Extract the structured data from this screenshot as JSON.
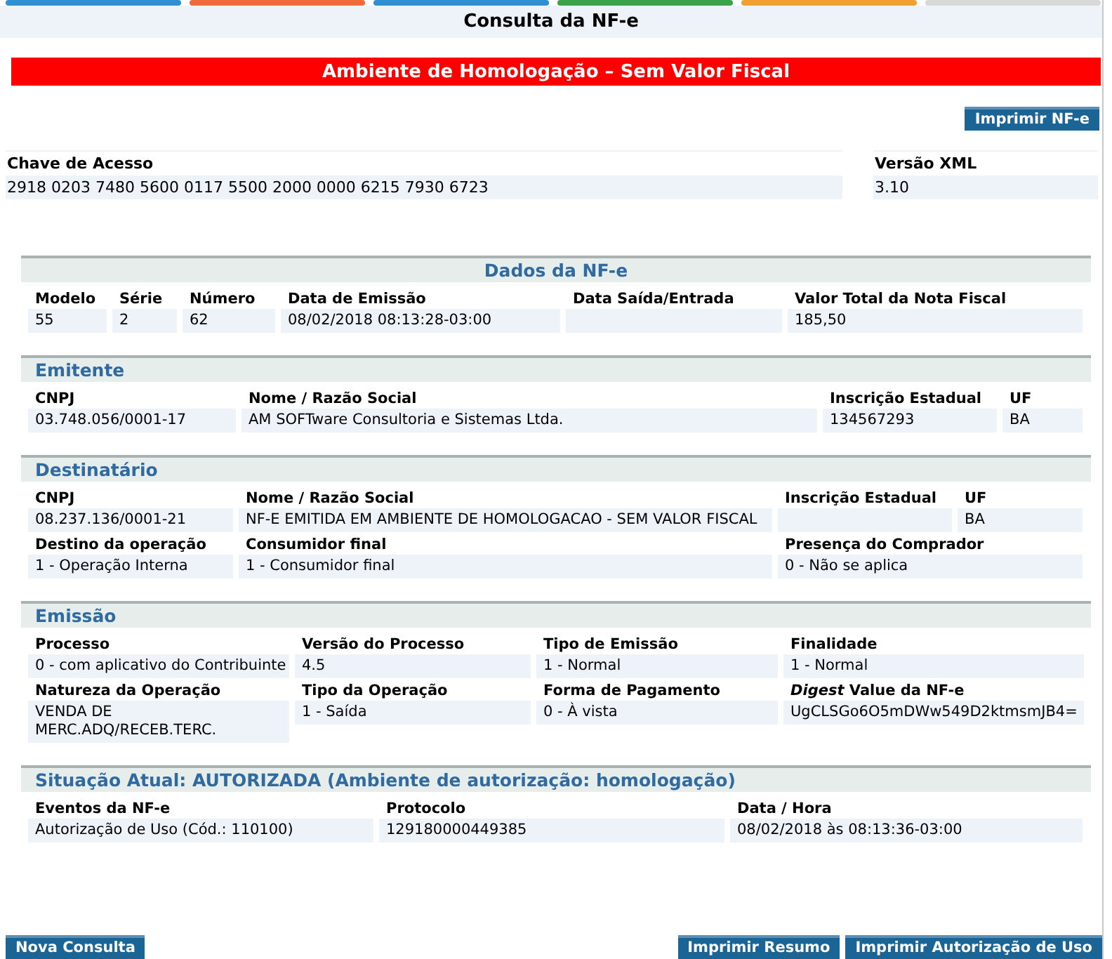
{
  "title": "Consulta da NF-e",
  "banner": "Ambiente de Homologação – Sem Valor Fiscal",
  "print_button": "Imprimir NF-e",
  "key": {
    "label": "Chave de Acesso",
    "value": "2918 0203 7480 5600 0117 5500 2000 0000 6215 7930 6723"
  },
  "xml_version": {
    "label": "Versão XML",
    "value": "3.10"
  },
  "sections": [
    {
      "title": "Dados da NF-e",
      "centered": true,
      "rows": [
        [
          {
            "label": "Modelo",
            "value": "55"
          },
          {
            "label": "Série",
            "value": "2"
          },
          {
            "label": "Número",
            "value": "62"
          },
          {
            "label": "Data de Emissão",
            "value": "08/02/2018 08:13:28-03:00"
          },
          {
            "label": "Data Saída/Entrada"
          },
          {
            "label": "Valor Total da Nota Fiscal",
            "value": "185,50"
          }
        ]
      ]
    },
    {
      "title": "Emitente",
      "centered": false,
      "rows": [
        [
          {
            "label": "CNPJ",
            "value": "03.748.056/0001-17"
          },
          {
            "label": "Nome / Razão Social",
            "value": "AM SOFTware Consultoria e Sistemas Ltda."
          },
          {
            "label": "Inscrição Estadual",
            "value": "134567293"
          },
          {
            "label": "UF",
            "value": "BA"
          }
        ]
      ]
    },
    {
      "title": "Destinatário",
      "centered": false,
      "rows": [
        [
          {
            "label": "CNPJ",
            "value": "08.237.136/0001-21"
          },
          {
            "label": "Nome / Razão Social",
            "value": "NF-E EMITIDA EM AMBIENTE DE HOMOLOGACAO - SEM VALOR FISCAL"
          },
          {
            "label": "Inscrição Estadual"
          },
          {
            "label": "UF",
            "value": "BA"
          }
        ],
        [
          {
            "label": "Destino da operação",
            "value": "1 - Operação Interna"
          },
          {
            "label": "Consumidor final",
            "value": "1 - Consumidor final"
          },
          {
            "label": "Presença do Comprador",
            "value": "0 - Não se aplica"
          }
        ]
      ]
    },
    {
      "title": "Emissão",
      "centered": false,
      "rows": [
        [
          {
            "label": "Processo",
            "value": "0 - com aplicativo do Contribuinte"
          },
          {
            "label": "Versão do Processo",
            "value": "4.5"
          },
          {
            "label": "Tipo de Emissão",
            "value": "1 - Normal"
          },
          {
            "label": "Finalidade",
            "value": "1 - Normal"
          }
        ],
        [
          {
            "label": "Natureza da Operação",
            "value": "VENDA DE MERC.ADQ/RECEB.TERC."
          },
          {
            "label": "Tipo da Operação",
            "value": "1 - Saída"
          },
          {
            "label": "Forma de Pagamento",
            "value": "0 - À vista"
          },
          {
            "label": "*Digest* Value da NF-e",
            "value": "UgCLSGo6O5mDWw549D2ktmsmJB4="
          }
        ]
      ]
    },
    {
      "title": "Situação Atual:  AUTORIZADA (Ambiente de autorização: homologação)",
      "centered": false,
      "rows": [
        [
          {
            "label": "Eventos da NF-e",
            "value": "Autorização de Uso (Cód.: 110100)"
          },
          {
            "label": "Protocolo",
            "value": "129180000449385"
          },
          {
            "label": "Data / Hora",
            "value": "08/02/2018 às 08:13:36-03:00"
          }
        ]
      ]
    }
  ],
  "footer_left": [
    "Nova Consulta"
  ],
  "footer_right": [
    "Imprimir Resumo",
    "Imprimir Autorização de Uso"
  ]
}
